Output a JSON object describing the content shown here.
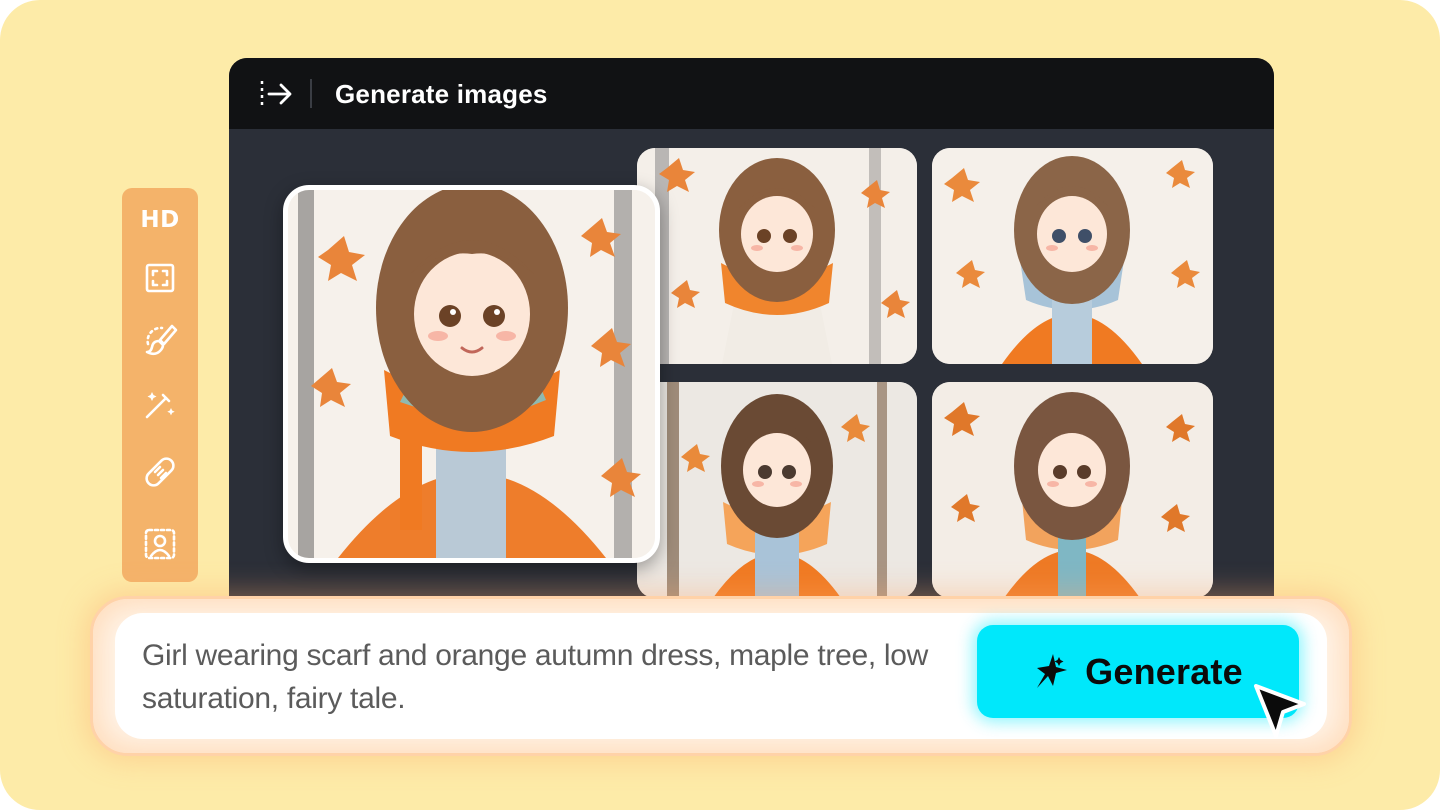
{
  "window": {
    "title": "Generate images",
    "collapse_icon": "sidebar-collapse-arrow-icon"
  },
  "images": [
    {
      "id": "selected",
      "subject": "girl with scarf, maple leaves"
    },
    {
      "id": "top-middle",
      "subject": "girl with scarf, maple leaves"
    },
    {
      "id": "top-right",
      "subject": "girl with scarf, maple leaves"
    },
    {
      "id": "bottom-middle",
      "subject": "girl with scarf, maple leaves"
    },
    {
      "id": "bottom-right",
      "subject": "girl with scarf, maple leaves"
    }
  ],
  "toolbar": {
    "hd_label": "HD",
    "tools": [
      "hd",
      "expand-frame-icon",
      "brush-icon",
      "magic-wand-icon",
      "bandage-icon",
      "portrait-icon"
    ]
  },
  "prompt": {
    "text": "Girl wearing scarf and orange autumn dress, maple tree, low saturation, fairy tale."
  },
  "generate_button": {
    "label": "Generate",
    "icon": "sparkle-icon"
  },
  "colors": {
    "background": "#fdeba8",
    "window": "#2b2f38",
    "titlebar": "#111214",
    "toolbar": "#f4b36a",
    "accent": "#00e8fb"
  }
}
